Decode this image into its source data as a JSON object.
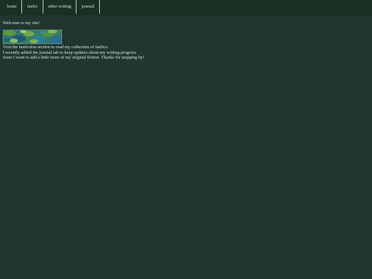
{
  "nav": {
    "items": [
      "home",
      "fanfic",
      "other writing",
      "journal"
    ]
  },
  "main": {
    "welcome": "Welcome to my site!",
    "lines": [
      "Visit the fanfiction section to read my collection of fanfics.",
      "I recently added the journal tab to keep updates about my writing progress.",
      "Soon I want to add a little more of my original fiction. Thanks for stopping by!"
    ]
  },
  "colors": {
    "page_bg": "#21362f",
    "navbar_bg": "#1a3025",
    "text": "#e6ece8"
  },
  "banner": {
    "icon": "decorative-banner-image"
  }
}
